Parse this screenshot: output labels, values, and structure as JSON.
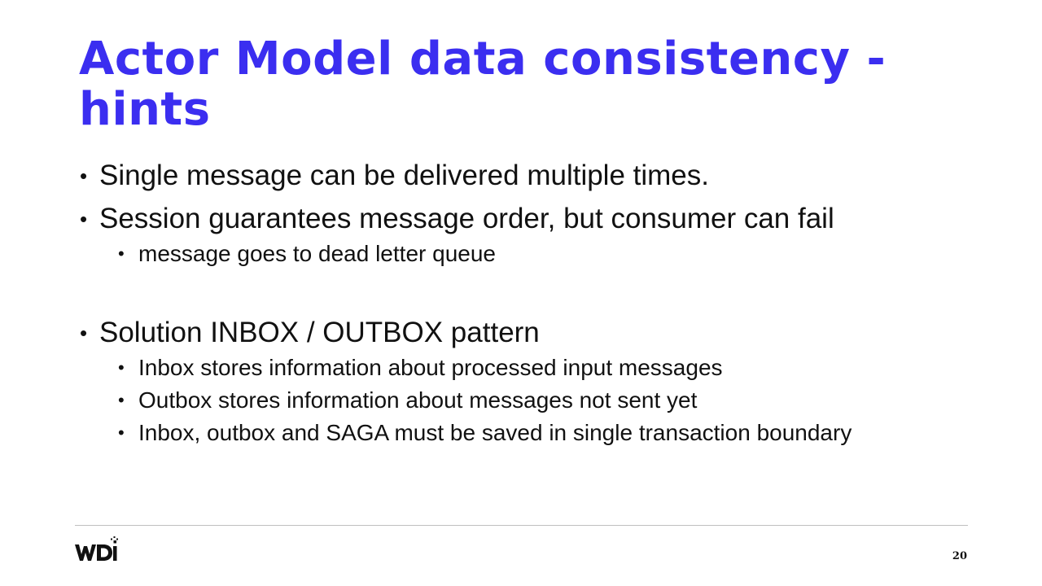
{
  "slide": {
    "title": "Actor Model data consistency - hints",
    "bullets": [
      {
        "text": "Single message can be delivered multiple times."
      },
      {
        "text": "Session guarantees message order, but consumer can fail",
        "sub": [
          "message goes to dead letter queue"
        ]
      },
      {
        "text": "Solution INBOX / OUTBOX pattern",
        "sub": [
          "Inbox stores information about processed input messages",
          "Outbox stores information about messages not sent yet",
          "Inbox, outbox and SAGA must be saved in single transaction boundary"
        ]
      }
    ],
    "bullet_glyph": "•",
    "page_number": "20",
    "logo": {
      "text": "WDI",
      "icon": "wdi-logo-icon"
    },
    "colors": {
      "title": "#3b2ef0",
      "text": "#111111",
      "rule": "#bfbfbf"
    }
  }
}
